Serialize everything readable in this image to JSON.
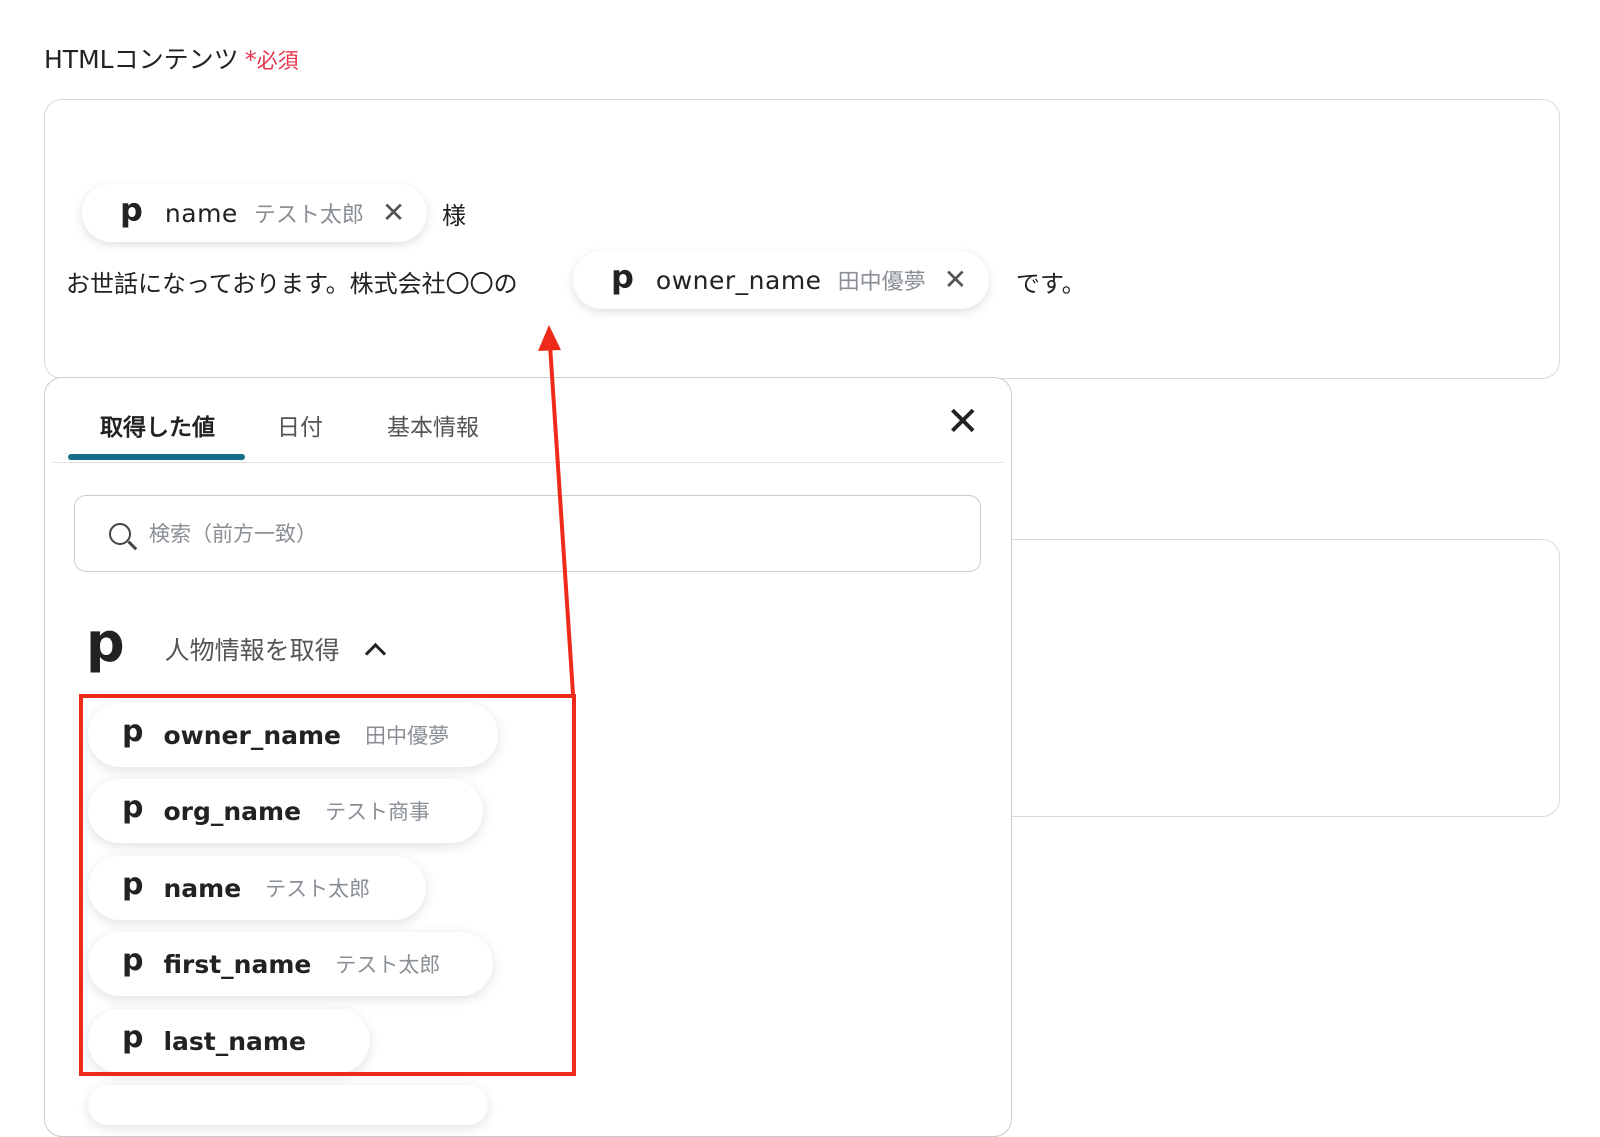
{
  "field": {
    "label": "HTMLコンテンツ",
    "required_mark": "*",
    "required_text": "必須"
  },
  "editor": {
    "line1": {
      "chip": {
        "icon": "p",
        "name": "name",
        "value": "テスト太郎",
        "remove": "✕"
      },
      "suffix": "様"
    },
    "line2": {
      "prefix": "お世話になっております。株式会社〇〇の",
      "chip": {
        "icon": "p",
        "name": "owner_name",
        "value": "田中優夢",
        "remove": "✕"
      },
      "suffix": "です。"
    }
  },
  "popup": {
    "tabs": [
      {
        "label": "取得した値",
        "active": true
      },
      {
        "label": "日付",
        "active": false
      },
      {
        "label": "基本情報",
        "active": false
      }
    ],
    "close": "✕",
    "search": {
      "placeholder": "検索（前方一致）",
      "value": ""
    },
    "group": {
      "icon": "p",
      "title": "人物情報を取得",
      "expanded": true
    },
    "items": [
      {
        "icon": "p",
        "name": "owner_name",
        "value": "田中優夢"
      },
      {
        "icon": "p",
        "name": "org_name",
        "value": "テスト商事"
      },
      {
        "icon": "p",
        "name": "name",
        "value": "テスト太郎"
      },
      {
        "icon": "p",
        "name": "first_name",
        "value": "テスト太郎"
      },
      {
        "icon": "p",
        "name": "last_name",
        "value": ""
      }
    ]
  },
  "annotation": {
    "color": "#ee2a1b"
  },
  "colors": {
    "accent": "#176c86",
    "required": "#e5334b"
  }
}
